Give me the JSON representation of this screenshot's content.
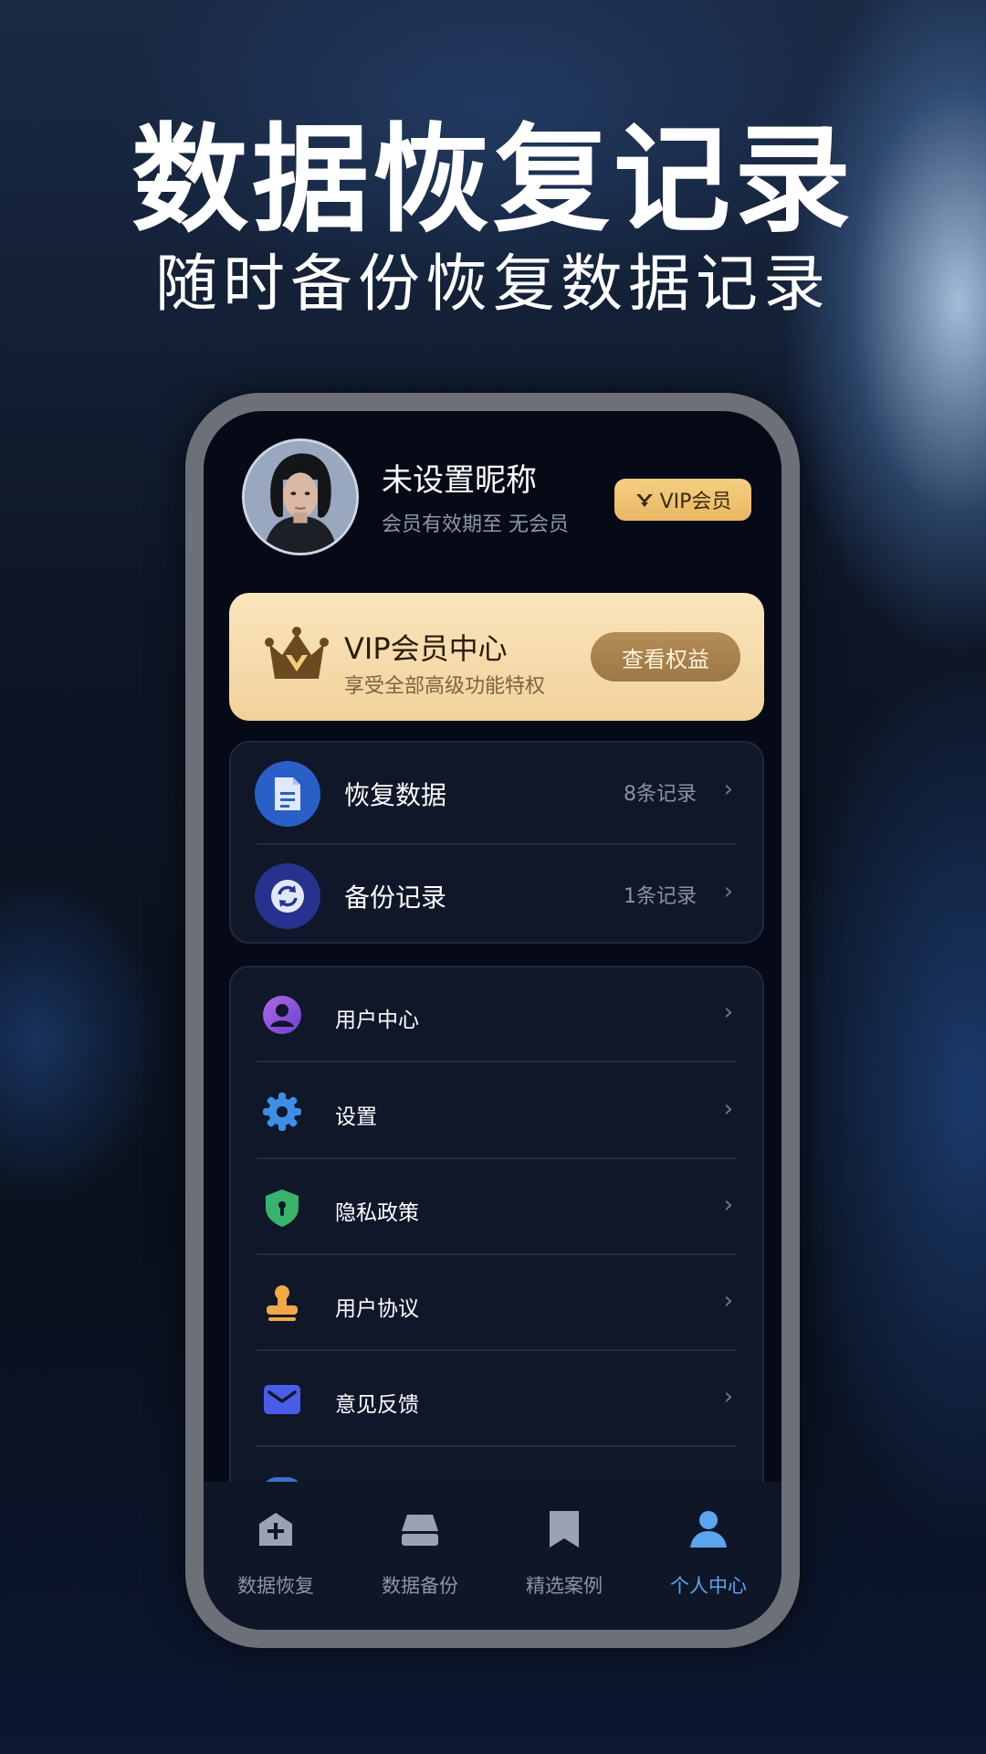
{
  "hero": {
    "title": "数据恢复记录",
    "subtitle": "随时备份恢复数据记录"
  },
  "profile": {
    "nickname": "未设置昵称",
    "expiry": "会员有效期至 无会员",
    "vip_badge": "VIP会员"
  },
  "vip_card": {
    "title": "VIP会员中心",
    "desc": "享受全部高级功能特权",
    "button": "查看权益"
  },
  "records": [
    {
      "label": "恢复数据",
      "count": "8条记录",
      "icon": "document-icon"
    },
    {
      "label": "备份记录",
      "count": "1条记录",
      "icon": "sync-icon"
    }
  ],
  "menu": [
    {
      "label": "用户中心",
      "icon": "user-icon"
    },
    {
      "label": "设置",
      "icon": "gear-icon"
    },
    {
      "label": "隐私政策",
      "icon": "shield-icon"
    },
    {
      "label": "用户协议",
      "icon": "stamp-icon"
    },
    {
      "label": "意见反馈",
      "icon": "mail-icon"
    }
  ],
  "tabs": [
    {
      "label": "数据恢复",
      "icon": "recover-icon",
      "active": false
    },
    {
      "label": "数据备份",
      "icon": "backup-icon",
      "active": false
    },
    {
      "label": "精选案例",
      "icon": "bookmark-icon",
      "active": false
    },
    {
      "label": "个人中心",
      "icon": "person-icon",
      "active": true
    }
  ],
  "colors": {
    "accent": "#5aa6ee",
    "gold": "#f1d29c",
    "background": "#050a16"
  }
}
